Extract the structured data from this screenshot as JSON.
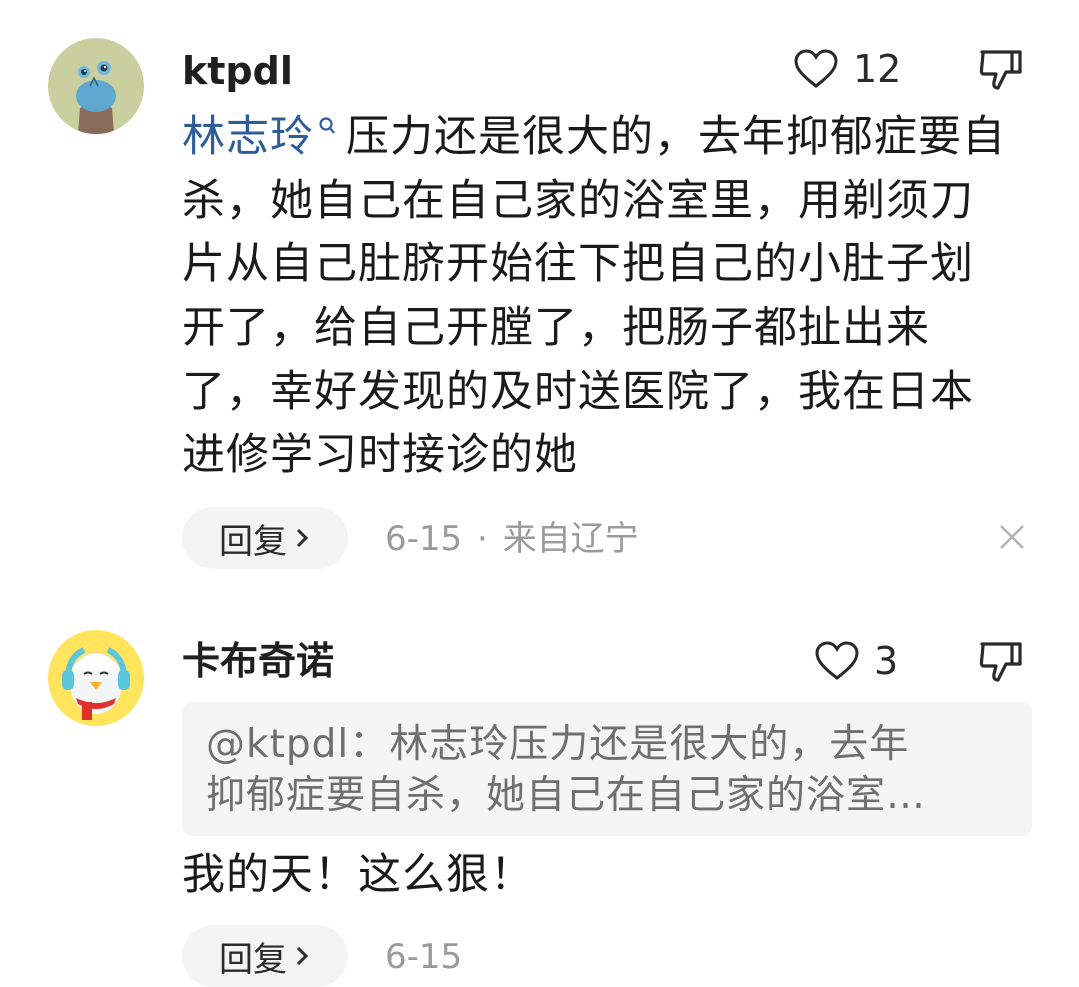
{
  "comments": [
    {
      "username": "ktpdl",
      "like_count": "12",
      "mention": "林志玲",
      "body": "压力还是很大的，去年抑郁症要自杀，她自己在自己家的浴室里，用剃须刀片从自己肚脐开始往下把自己的小肚子划开了，给自己开膛了，把肠子都扯出来了，幸好发现的及时送医院了，我在日本进修学习时接诊的她",
      "reply_label": "回复",
      "date": "6-15",
      "separator": "·",
      "location": "来自辽宁",
      "avatar_icon": "cartoon-character-avatar-icon"
    },
    {
      "username": "卡布奇诺",
      "like_count": "3",
      "quote_line1": "@ktpdl：林志玲压力还是很大的，去年",
      "quote_line2": "抑郁症要自杀，她自己在自己家的浴室…",
      "body": "我的天！这么狠！",
      "reply_label": "回复",
      "date": "6-15",
      "avatar_icon": "penguin-avatar-icon"
    }
  ],
  "colors": {
    "mention": "#2f5d9a",
    "meta": "#9a9a9a",
    "quote_bg": "#f5f5f5",
    "reply_bg": "#f4f4f4"
  }
}
